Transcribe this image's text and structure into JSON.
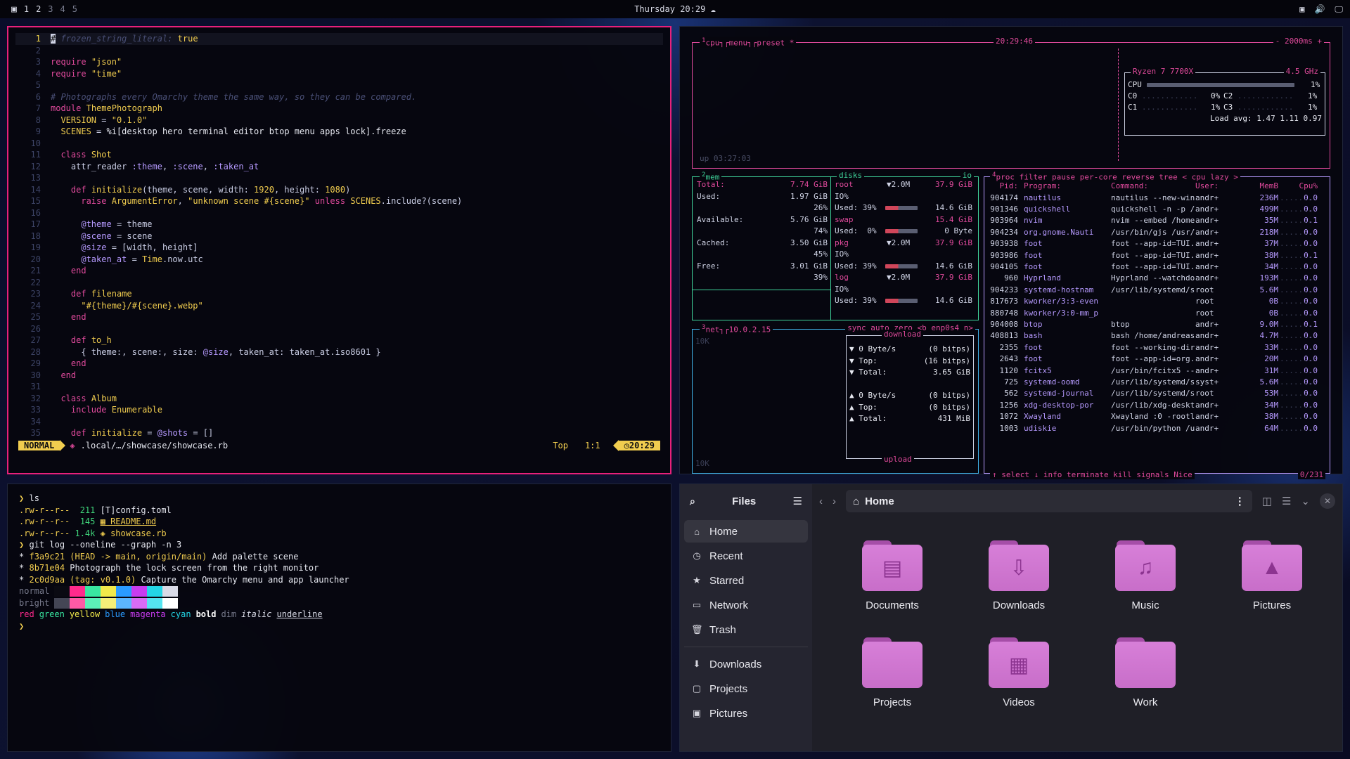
{
  "topbar": {
    "workspaces": [
      "1",
      "2",
      "3",
      "4",
      "5"
    ],
    "clock": "Thursday 20:29"
  },
  "nvim": {
    "lines": [
      {
        "n": "1",
        "html": "<span class='p' style='background:#cfd3e5;color:#111'>#</span> <span class='c'>frozen_string_literal:</span> <span class='s'>true</span>"
      },
      {
        "n": "2",
        "html": ""
      },
      {
        "n": "3",
        "html": "<span class='k'>require</span> <span class='s'>\"json\"</span>"
      },
      {
        "n": "4",
        "html": "<span class='k'>require</span> <span class='s'>\"time\"</span>"
      },
      {
        "n": "5",
        "html": ""
      },
      {
        "n": "6",
        "html": "<span class='c'># Photographs every Omarchy theme the same way, so they can be compared.</span>"
      },
      {
        "n": "7",
        "html": "<span class='k'>module</span> <span class='t'>ThemePhotograph</span>"
      },
      {
        "n": "8",
        "html": "  <span class='t'>VERSION</span> = <span class='s'>\"0.1.0\"</span>"
      },
      {
        "n": "9",
        "html": "  <span class='t'>SCENES</span> = <span class='p'>%i[desktop hero terminal editor btop menu apps lock].freeze</span>"
      },
      {
        "n": "10",
        "html": ""
      },
      {
        "n": "11",
        "html": "  <span class='k'>class</span> <span class='t'>Shot</span>"
      },
      {
        "n": "12",
        "html": "    attr_reader <span class='sy'>:theme</span>, <span class='sy'>:scene</span>, <span class='sy'>:taken_at</span>"
      },
      {
        "n": "13",
        "html": ""
      },
      {
        "n": "14",
        "html": "    <span class='k'>def</span> <span class='t'>initialize</span>(theme, scene, width: <span class='s'>1920</span>, height: <span class='s'>1080</span>)"
      },
      {
        "n": "15",
        "html": "      <span class='k'>raise</span> <span class='t'>ArgumentError</span>, <span class='s'>\"unknown scene #{scene}\"</span> <span class='k'>unless</span> <span class='t'>SCENES</span>.include?(scene)"
      },
      {
        "n": "16",
        "html": ""
      },
      {
        "n": "17",
        "html": "      <span class='sy'>@theme</span> = theme"
      },
      {
        "n": "18",
        "html": "      <span class='sy'>@scene</span> = scene"
      },
      {
        "n": "19",
        "html": "      <span class='sy'>@size</span> = [width, height]"
      },
      {
        "n": "20",
        "html": "      <span class='sy'>@taken_at</span> = <span class='t'>Time</span>.now.utc"
      },
      {
        "n": "21",
        "html": "    <span class='k'>end</span>"
      },
      {
        "n": "22",
        "html": ""
      },
      {
        "n": "23",
        "html": "    <span class='k'>def</span> <span class='t'>filename</span>"
      },
      {
        "n": "24",
        "html": "      <span class='s'>\"#{theme}/#{scene}.webp\"</span>"
      },
      {
        "n": "25",
        "html": "    <span class='k'>end</span>"
      },
      {
        "n": "26",
        "html": ""
      },
      {
        "n": "27",
        "html": "    <span class='k'>def</span> <span class='t'>to_h</span>"
      },
      {
        "n": "28",
        "html": "      { theme:, scene:, size: <span class='sy'>@size</span>, taken_at: taken_at.iso8601 }"
      },
      {
        "n": "29",
        "html": "    <span class='k'>end</span>"
      },
      {
        "n": "30",
        "html": "  <span class='k'>end</span>"
      },
      {
        "n": "31",
        "html": ""
      },
      {
        "n": "32",
        "html": "  <span class='k'>class</span> <span class='t'>Album</span>"
      },
      {
        "n": "33",
        "html": "    <span class='k'>include</span> <span class='t'>Enumerable</span>"
      },
      {
        "n": "34",
        "html": ""
      },
      {
        "n": "35",
        "html": "    <span class='k'>def</span> <span class='t'>initialize</span> = <span class='sy'>@shots</span> = []"
      }
    ],
    "mode": "NORMAL",
    "file": ".local/…/showcase/showcase.rb",
    "pos_label": "Top",
    "cursor": "1:1",
    "time": "20:29"
  },
  "btop": {
    "cpu": {
      "tabs": [
        "cpu",
        "menu",
        "preset *"
      ],
      "time": "20:29:46",
      "interval": "- 2000ms +",
      "model": "Ryzen 7 7700X",
      "freq": "4.5 GHz",
      "rows": [
        {
          "l": "CPU",
          "v": "1%"
        },
        {
          "l": "C0",
          "v": "0%"
        },
        {
          "l": "C2",
          "v": "1%"
        },
        {
          "l": "C1",
          "v": "1%"
        },
        {
          "l": "C3",
          "v": "1%"
        }
      ],
      "load": "Load avg: 1.47 1.11 0.97",
      "uptime": "up 03:27:03"
    },
    "mem": {
      "title": "mem",
      "rows": [
        [
          "Total:",
          "7.74 GiB"
        ],
        [
          "Used:",
          "1.97 GiB"
        ],
        [
          "",
          "26%"
        ],
        [
          "Available:",
          "5.76 GiB"
        ],
        [
          "",
          "74%"
        ],
        [
          "Cached:",
          "3.50 GiB"
        ],
        [
          "",
          "45%"
        ],
        [
          "Free:",
          "3.01 GiB"
        ],
        [
          "",
          "39%"
        ]
      ]
    },
    "disks": {
      "title": "disks",
      "io": "io",
      "rows": [
        [
          "root",
          "▼2.0M",
          "37.9 GiB"
        ],
        [
          "IO%",
          "",
          " "
        ],
        [
          "Used: 39%",
          "",
          "14.6 GiB"
        ],
        [
          "swap",
          "",
          "15.4 GiB"
        ],
        [
          "Used:  0%",
          "",
          "0 Byte"
        ],
        [
          "pkg",
          "▼2.0M",
          "37.9 GiB"
        ],
        [
          "IO%",
          "",
          ""
        ],
        [
          "Used: 39%",
          "",
          "14.6 GiB"
        ],
        [
          "log",
          "▼2.0M",
          "37.9 GiB"
        ],
        [
          "IO%",
          "",
          ""
        ],
        [
          "Used: 39%",
          "",
          "14.6 GiB"
        ]
      ]
    },
    "net": {
      "title": "net",
      "ip": "10.0.2.15",
      "tabs": "sync auto zero <b enp0s4 n>",
      "scale": "10K",
      "download": "download",
      "upload": "upload",
      "dl": [
        [
          "▼ 0 Byte/s",
          "(0 bitps)"
        ],
        [
          "▼ Top:",
          "(16 bitps)"
        ],
        [
          "▼ Total:",
          "3.65 GiB"
        ]
      ],
      "ul": [
        [
          "▲ 0 Byte/s",
          "(0 bitps)"
        ],
        [
          "▲ Top:",
          "(0 bitps)"
        ],
        [
          "▲ Total:",
          "431 MiB"
        ]
      ]
    },
    "proc": {
      "tabs": "proc filter    pause per-core reverse tree < cpu lazy >",
      "header": [
        "Pid:",
        "Program:",
        "Command:",
        "User:",
        "MemB",
        "Cpu%"
      ],
      "rows": [
        [
          "904174",
          "nautilus",
          "nautilus --new-win",
          "andr+",
          "236M",
          "0.0"
        ],
        [
          "901346",
          "quickshell",
          "quickshell -n -p /",
          "andr+",
          "499M",
          "0.0"
        ],
        [
          "903964",
          "nvim",
          "nvim --embed /home",
          "andr+",
          "35M",
          "0.1"
        ],
        [
          "904234",
          "org.gnome.Nauti",
          "/usr/bin/gjs /usr/",
          "andr+",
          "218M",
          "0.0"
        ],
        [
          "903938",
          "foot",
          "foot --app-id=TUI.",
          "andr+",
          "37M",
          "0.0"
        ],
        [
          "903986",
          "foot",
          "foot --app-id=TUI.",
          "andr+",
          "38M",
          "0.1"
        ],
        [
          "904105",
          "foot",
          "foot --app-id=TUI.",
          "andr+",
          "34M",
          "0.0"
        ],
        [
          "960",
          "Hyprland",
          "Hyprland --watchdo",
          "andr+",
          "193M",
          "0.0"
        ],
        [
          "904233",
          "systemd-hostnam",
          "/usr/lib/systemd/s",
          "root",
          "5.6M",
          "0.0"
        ],
        [
          "817673",
          "kworker/3:3-even",
          "",
          "root",
          "0B",
          "0.0"
        ],
        [
          "880748",
          "kworker/3:0-mm_p",
          "",
          "root",
          "0B",
          "0.0"
        ],
        [
          "904008",
          "btop",
          "btop",
          "andr+",
          "9.0M",
          "0.1"
        ],
        [
          "408813",
          "bash",
          "bash /home/andreas",
          "andr+",
          "4.7M",
          "0.0"
        ],
        [
          "2355",
          "foot",
          "foot --working-dir",
          "andr+",
          "33M",
          "0.0"
        ],
        [
          "2643",
          "foot",
          "foot --app-id=org.",
          "andr+",
          "20M",
          "0.0"
        ],
        [
          "1120",
          "fcitx5",
          "/usr/bin/fcitx5 --",
          "andr+",
          "31M",
          "0.0"
        ],
        [
          "725",
          "systemd-oomd",
          "/usr/lib/systemd/s",
          "syst+",
          "5.6M",
          "0.0"
        ],
        [
          "562",
          "systemd-journal",
          "/usr/lib/systemd/s",
          "root",
          "53M",
          "0.0"
        ],
        [
          "1256",
          "xdg-desktop-por",
          "/usr/lib/xdg-deskt",
          "andr+",
          "34M",
          "0.0"
        ],
        [
          "1072",
          "Xwayland",
          "Xwayland :0 -rootl",
          "andr+",
          "38M",
          "0.0"
        ],
        [
          "1003",
          "udiskie",
          "/usr/bin/python /u",
          "andr+",
          "64M",
          "0.0"
        ]
      ],
      "footer": "↑ select ↓  info  terminate  kill  signals  Nice",
      "count": "0/231"
    }
  },
  "terminal": {
    "lines": [
      "<span style='color:#f1cd4f'>❯</span> <span class='p'>ls</span>",
      "<span style='color:#f1cd4f'>.rw-r--r--</span>  <span style='color:#3fd37a'>211</span> <span class='p'>[T]config.toml</span>",
      "<span style='color:#f1cd4f'>.rw-r--r--</span>  <span style='color:#3fd37a'>145</span> <span style='color:#f1cd4f;text-decoration:underline'>▦ README.md</span>",
      "<span style='color:#f1cd4f'>.rw-r--r--</span> <span style='color:#3fd37a'>1.4k</span> <span style='color:#f1cd4f'>◈ showcase.rb</span>",
      "<span style='color:#f1cd4f'>❯</span> <span class='p'>git log --oneline --graph -n 3</span>",
      "<span class='p'>*</span> <span style='color:#f1cd4f'>f3a9c21</span> <span style='color:#f1cd4f'>(HEAD -> main, origin/main)</span> <span class='p'>Add palette scene</span>",
      "<span class='p'>*</span> <span style='color:#f1cd4f'>8b71e04</span> <span class='p'>Photograph the lock screen from the right monitor</span>",
      "<span class='p'>*</span> <span style='color:#f1cd4f'>2c0d9aa</span> <span style='color:#f1cd4f'>(tag: v0.1.0)</span> <span class='p'>Capture the Omarchy menu and app launcher</span>"
    ],
    "palette_labels": [
      "normal",
      "bright"
    ],
    "palette": [
      "#0a0a12",
      "#ff2a8c",
      "#39e6a0",
      "#f1e94a",
      "#2a9bff",
      "#c83cf0",
      "#23d6e6",
      "#d8dae6"
    ],
    "palette_bright": [
      "#444655",
      "#ff5aa6",
      "#5cf0b8",
      "#f5ef78",
      "#5cb6ff",
      "#d86cf5",
      "#55e4f0",
      "#ffffff"
    ],
    "styles": [
      {
        "t": "red",
        "c": "#ff2a8c"
      },
      {
        "t": "green",
        "c": "#39e6a0"
      },
      {
        "t": "yellow",
        "c": "#f1e94a"
      },
      {
        "t": "blue",
        "c": "#2a9bff"
      },
      {
        "t": "magenta",
        "c": "#c83cf0"
      },
      {
        "t": "cyan",
        "c": "#23d6e6"
      },
      {
        "t": "bold",
        "c": "#ffffff"
      },
      {
        "t": "dim",
        "c": "#777a8c"
      },
      {
        "t": "italic",
        "c": "#d8dae6"
      },
      {
        "t": "underline",
        "c": "#d8dae6"
      }
    ],
    "prompt": "❯"
  },
  "files": {
    "title": "Files",
    "location": "Home",
    "sidebar": [
      {
        "icon": "⌂",
        "label": "Home",
        "name": "home"
      },
      {
        "icon": "◷",
        "label": "Recent",
        "name": "recent"
      },
      {
        "icon": "★",
        "label": "Starred",
        "name": "starred"
      },
      {
        "icon": "▭",
        "label": "Network",
        "name": "network"
      },
      {
        "icon": "🗑",
        "label": "Trash",
        "name": "trash"
      },
      {
        "icon": "⬇",
        "label": "Downloads",
        "name": "downloads"
      },
      {
        "icon": "▢",
        "label": "Projects",
        "name": "projects"
      },
      {
        "icon": "▣",
        "label": "Pictures",
        "name": "pictures"
      }
    ],
    "folders": [
      {
        "label": "Documents",
        "glyph": "▤"
      },
      {
        "label": "Downloads",
        "glyph": "⇩"
      },
      {
        "label": "Music",
        "glyph": "♫"
      },
      {
        "label": "Pictures",
        "glyph": "▲"
      },
      {
        "label": "Projects",
        "glyph": ""
      },
      {
        "label": "Videos",
        "glyph": "▦"
      },
      {
        "label": "Work",
        "glyph": ""
      }
    ]
  }
}
